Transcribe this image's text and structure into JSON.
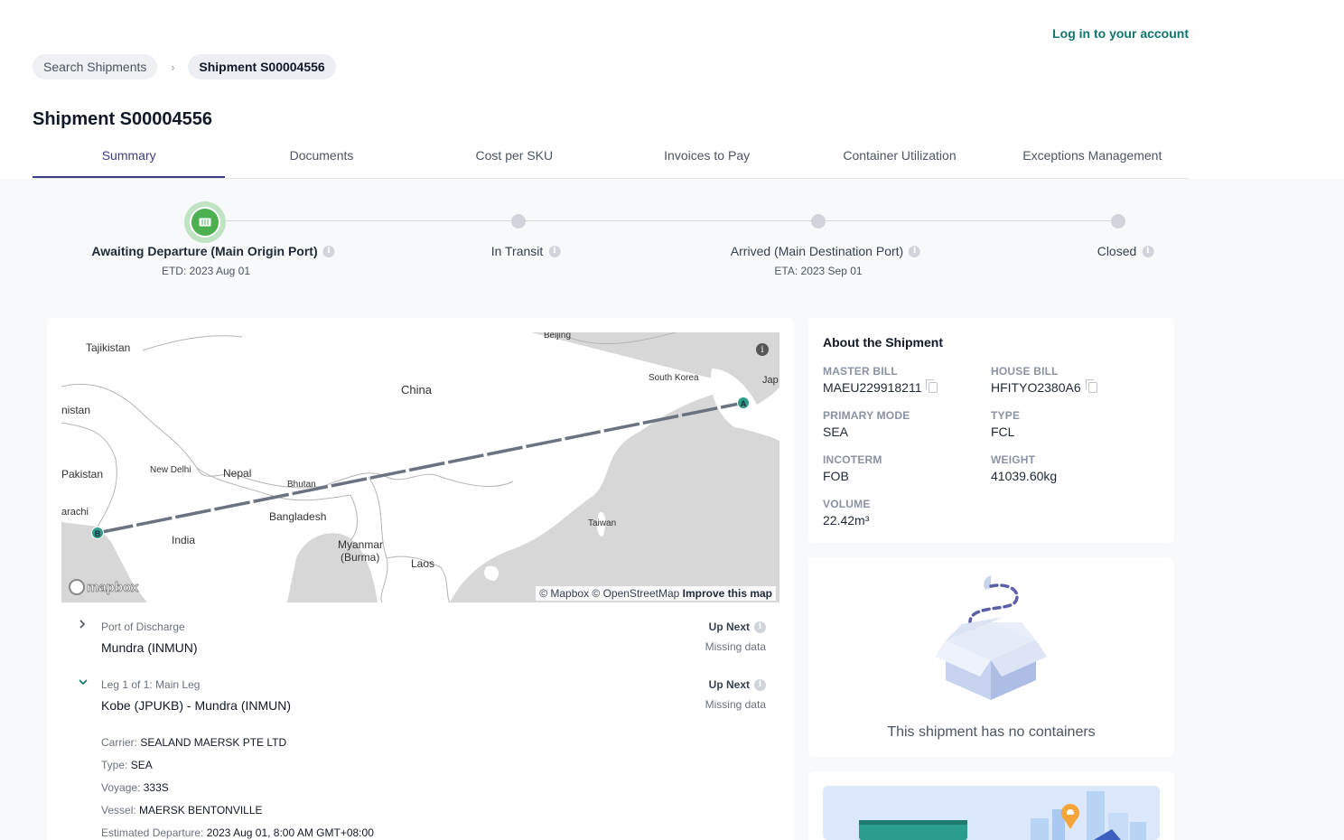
{
  "header": {
    "login_label": "Log in to your account"
  },
  "breadcrumb": {
    "items": [
      "Search Shipments",
      "Shipment S00004556"
    ],
    "separator": "›"
  },
  "page": {
    "title": "Shipment S00004556"
  },
  "tabs": [
    "Summary",
    "Documents",
    "Cost per SKU",
    "Invoices to Pay",
    "Container Utilization",
    "Exceptions Management"
  ],
  "progress": {
    "steps": [
      {
        "label": "Awaiting Departure (Main Origin Port)",
        "sub": "ETD: 2023 Aug 01",
        "active": true
      },
      {
        "label": "In Transit",
        "sub": ""
      },
      {
        "label": "Arrived (Main Destination Port)",
        "sub": "ETA: 2023 Sep 01"
      },
      {
        "label": "Closed",
        "sub": ""
      }
    ]
  },
  "map": {
    "labels": {
      "beijing": "Beijing",
      "tajikistan": "Tajikistan",
      "china": "China",
      "south_korea": "South Korea",
      "japan": "Jap",
      "afghanistan": "nistan",
      "new_delhi": "New Delhi",
      "nepal": "Nepal",
      "bhutan": "Bhutan",
      "pakistan": "Pakistan",
      "karachi": "arachi",
      "bangladesh": "Bangladesh",
      "india": "India",
      "myanmar": "Myanmar",
      "burma": "(Burma)",
      "laos": "Laos",
      "taiwan": "Taiwan"
    },
    "marker_a": "A",
    "marker_b": "B",
    "logo": "mapbox",
    "credit_text": "© Mapbox © OpenStreetMap",
    "credit_link": "Improve this map",
    "info": "i"
  },
  "legs": {
    "discharge": {
      "caption": "Port of Discharge",
      "title": "Mundra (INMUN)",
      "upnext": "Up Next",
      "missing": "Missing data"
    },
    "main": {
      "caption": "Leg 1 of 1: Main Leg",
      "title": "Kobe (JPUKB) - Mundra (INMUN)",
      "upnext": "Up Next",
      "missing": "Missing data"
    },
    "details": [
      {
        "key": "Carrier:",
        "value": "SEALAND MAERSK PTE LTD"
      },
      {
        "key": "Type:",
        "value": "SEA"
      },
      {
        "key": "Voyage:",
        "value": "333S"
      },
      {
        "key": "Vessel:",
        "value": "MAERSK BENTONVILLE"
      },
      {
        "key": "Estimated Departure:",
        "value": "2023 Aug 01, 8:00 AM GMT+08:00"
      }
    ]
  },
  "about": {
    "title": "About the Shipment",
    "master_bill": {
      "label": "MASTER BILL",
      "value": "MAEU229918211"
    },
    "house_bill": {
      "label": "HOUSE BILL",
      "value": "HFITYO2380A6"
    },
    "primary_mode": {
      "label": "PRIMARY MODE",
      "value": "SEA"
    },
    "type": {
      "label": "TYPE",
      "value": "FCL"
    },
    "incoterm": {
      "label": "INCOTERM",
      "value": "FOB"
    },
    "weight": {
      "label": "WEIGHT",
      "value": "41039.60kg"
    },
    "volume": {
      "label": "VOLUME",
      "value": "22.42m³"
    }
  },
  "containers": {
    "empty_text": "This shipment has no containers"
  },
  "colors": {
    "accent": "#3b3f86",
    "teal": "#0f766e",
    "success": "#4caf50"
  }
}
